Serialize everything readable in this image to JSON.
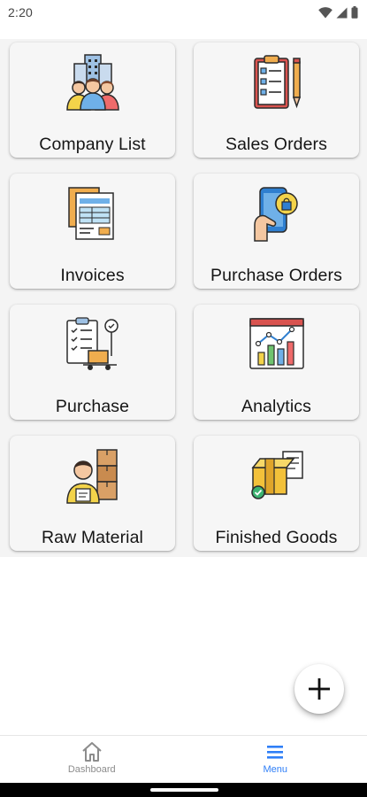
{
  "status_bar": {
    "time": "2:20"
  },
  "menu": {
    "tiles": [
      {
        "label": "Company List",
        "icon": "company-team-icon"
      },
      {
        "label": "Sales Orders",
        "icon": "clipboard-pen-icon"
      },
      {
        "label": "Invoices",
        "icon": "invoice-documents-icon"
      },
      {
        "label": "Purchase Orders",
        "icon": "mobile-shopping-icon"
      },
      {
        "label": "Purchase",
        "icon": "checklist-delivery-icon"
      },
      {
        "label": "Analytics",
        "icon": "analytics-chart-icon"
      },
      {
        "label": "Raw Material",
        "icon": "worker-boxes-icon"
      },
      {
        "label": "Finished Goods",
        "icon": "package-checked-icon"
      }
    ]
  },
  "fab": {
    "icon": "plus-icon"
  },
  "bottom_nav": {
    "items": [
      {
        "label": "Dashboard",
        "icon": "home-icon",
        "active": false
      },
      {
        "label": "Menu",
        "icon": "hamburger-menu-icon",
        "active": true
      }
    ]
  },
  "colors": {
    "accent": "#2f7ff7",
    "inactive": "#8c8c8c",
    "tile_bg": "#f6f6f6"
  }
}
